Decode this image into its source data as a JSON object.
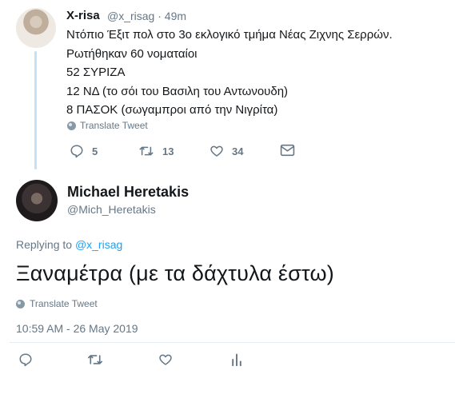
{
  "tweet1": {
    "author_name": "X-risa",
    "author_handle_time": "@x_risag · 49m",
    "lines": [
      "Ντόπιο Έξιτ πολ στο 3ο εκλογικό τμήμα Νέας Ζιχνης Σερρών.",
      "Ρωτήθηκαν 60 νοματαίοι",
      "52 ΣΥΡΙΖΑ",
      "12 ΝΔ (το σόι του Βασιλη του Αντωνουδη)",
      "8 ΠΑΣΟΚ (σωγαμπροι από την Νιγρίτα)"
    ],
    "translate_label": "Translate Tweet",
    "reply_count": "5",
    "retweet_count": "13",
    "like_count": "34",
    "icons": [
      "reply-icon",
      "retweet-icon",
      "like-icon",
      "message-icon"
    ]
  },
  "tweet2": {
    "author_name": "Michael Heretakis",
    "author_handle": "@Mich_Heretakis",
    "replying_prefix": "Replying to",
    "replying_handle": "@x_risag",
    "text": "Ξαναμέτρα (με τα δάχτυλα έστω)",
    "translate_label": "Translate Tweet",
    "timestamp": "10:59 AM - 26 May 2019",
    "icons": [
      "reply-icon",
      "retweet-icon",
      "like-icon",
      "analytics-icon"
    ]
  },
  "colors": {
    "text": "#14171a",
    "secondary": "#657786",
    "link": "#1da1f2",
    "thread_line": "#c4e1f5"
  }
}
